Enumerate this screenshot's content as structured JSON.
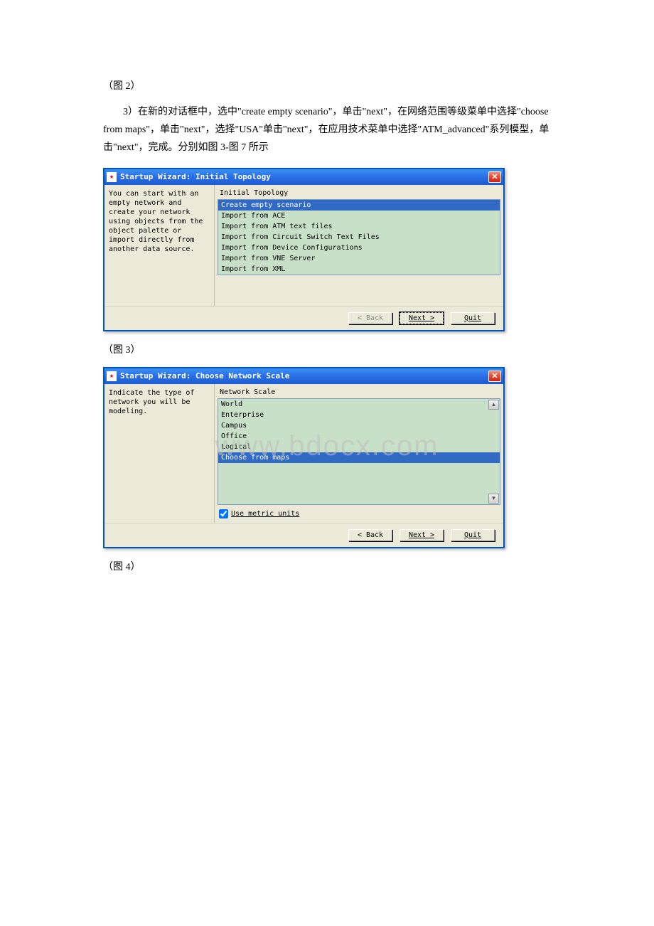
{
  "caption_fig2": "（图 2）",
  "instructions_line": "3）在新的对话框中，选中\"create empty scenario\"，单击\"next\"，在网络范围等级菜单中选择\"choose from maps\"，单击\"next\"，选择\"USA\"单击\"next\"，在应用技术菜单中选择\"ATM_advanced\"系列模型，单击\"next\"，完成。分别如图 3-图 7 所示",
  "caption_fig3": "（图 3）",
  "caption_fig4": "（图 4）",
  "watermark": "www.bdocx.com",
  "dialog1": {
    "title": "Startup Wizard: Initial Topology",
    "close_x": "✕",
    "left_text": "You can start with an empty network and create your network using objects from the object palette or import directly from another data source.",
    "header": "Initial Topology",
    "items": [
      "Create empty scenario",
      "Import from ACE",
      "Import from ATM text files",
      "Import from Circuit Switch Text Files",
      "Import from Device Configurations",
      "Import from VNE Server",
      "Import from XML"
    ],
    "selected_index": 0,
    "back_btn": "< Back",
    "next_btn": "Next >",
    "quit_btn": "Quit"
  },
  "dialog2": {
    "title": "Startup Wizard: Choose Network Scale",
    "close_x": "✕",
    "left_text": "Indicate the type of network you will be modeling.",
    "header": "Network Scale",
    "items": [
      "World",
      "Enterprise",
      "Campus",
      "Office",
      "Logical",
      "Choose from maps"
    ],
    "selected_index": 5,
    "checkbox_label": "Use metric units",
    "back_btn": "< Back",
    "next_btn": "Next >",
    "quit_btn": "Quit"
  }
}
